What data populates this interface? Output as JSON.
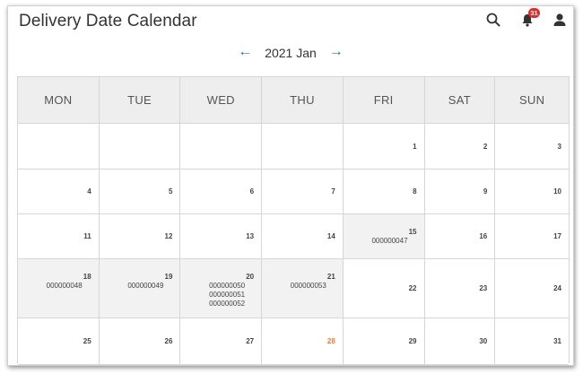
{
  "page": {
    "title": "Delivery Date Calendar"
  },
  "header": {
    "notification_count": "31"
  },
  "nav": {
    "prev": "←",
    "month": "2021 Jan",
    "next": "→"
  },
  "calendar": {
    "weekdays": [
      "MON",
      "TUE",
      "WED",
      "THU",
      "FRI",
      "SAT",
      "SUN"
    ],
    "weeks": [
      [
        {
          "day": "",
          "orders": []
        },
        {
          "day": "",
          "orders": []
        },
        {
          "day": "",
          "orders": []
        },
        {
          "day": "",
          "orders": []
        },
        {
          "day": "1",
          "orders": []
        },
        {
          "day": "2",
          "orders": []
        },
        {
          "day": "3",
          "orders": []
        }
      ],
      [
        {
          "day": "4",
          "orders": []
        },
        {
          "day": "5",
          "orders": []
        },
        {
          "day": "6",
          "orders": []
        },
        {
          "day": "7",
          "orders": []
        },
        {
          "day": "8",
          "orders": []
        },
        {
          "day": "9",
          "orders": []
        },
        {
          "day": "10",
          "orders": []
        }
      ],
      [
        {
          "day": "11",
          "orders": []
        },
        {
          "day": "12",
          "orders": []
        },
        {
          "day": "13",
          "orders": []
        },
        {
          "day": "14",
          "orders": []
        },
        {
          "day": "15",
          "orders": [
            "000000047"
          ]
        },
        {
          "day": "16",
          "orders": []
        },
        {
          "day": "17",
          "orders": []
        }
      ],
      [
        {
          "day": "18",
          "orders": [
            "000000048"
          ]
        },
        {
          "day": "19",
          "orders": [
            "000000049"
          ]
        },
        {
          "day": "20",
          "orders": [
            "000000050",
            "000000051",
            "000000052"
          ]
        },
        {
          "day": "21",
          "orders": [
            "000000053"
          ]
        },
        {
          "day": "22",
          "orders": []
        },
        {
          "day": "23",
          "orders": []
        },
        {
          "day": "24",
          "orders": []
        }
      ],
      [
        {
          "day": "25",
          "orders": []
        },
        {
          "day": "26",
          "orders": []
        },
        {
          "day": "27",
          "orders": []
        },
        {
          "day": "28",
          "orders": [],
          "today": true
        },
        {
          "day": "29",
          "orders": []
        },
        {
          "day": "30",
          "orders": []
        },
        {
          "day": "31",
          "orders": []
        }
      ]
    ]
  },
  "colors": {
    "accent": "#1979c3",
    "today": "#ed7d31",
    "badge": "#e02b27",
    "highlight": "#f2f2f2",
    "header_bg": "#eeeeee"
  },
  "icons": {
    "search": "search-icon",
    "notifications": "bell-icon",
    "account": "user-icon"
  }
}
